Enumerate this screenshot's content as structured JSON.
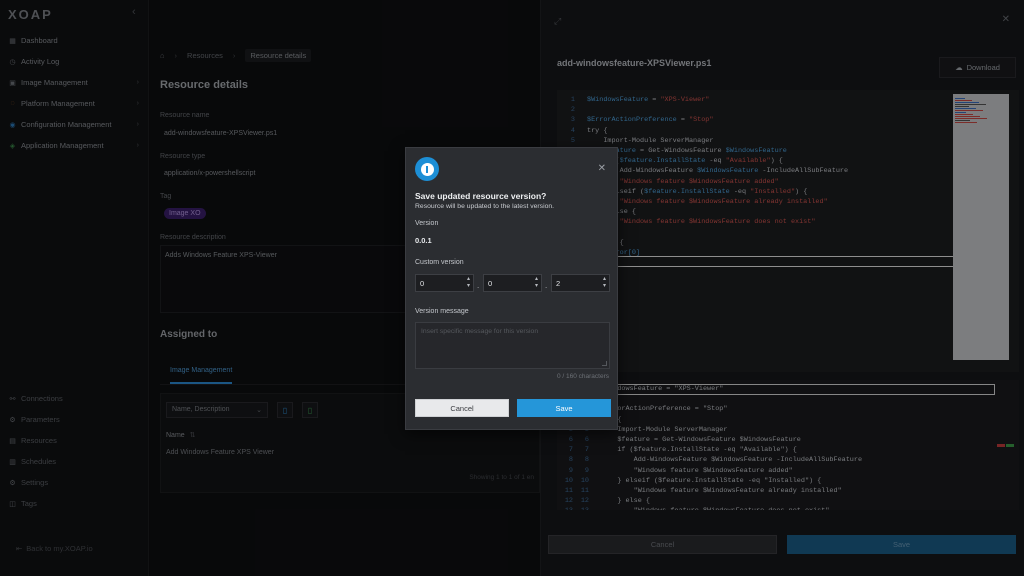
{
  "app": {
    "logo": "XOAP"
  },
  "sidebar": {
    "items": [
      {
        "label": "Dashboard",
        "icon": "dashboard-icon"
      },
      {
        "label": "Activity Log",
        "icon": "clock-icon"
      },
      {
        "label": "Image Management",
        "icon": "image-icon"
      },
      {
        "label": "Platform Management",
        "icon": "platform-icon"
      },
      {
        "label": "Configuration Management",
        "icon": "config-icon"
      },
      {
        "label": "Application Management",
        "icon": "apps-icon"
      }
    ],
    "bottom_items": [
      {
        "label": "Connections",
        "icon": "link-icon"
      },
      {
        "label": "Parameters",
        "icon": "parameters-icon"
      },
      {
        "label": "Resources",
        "icon": "resources-icon"
      },
      {
        "label": "Schedules",
        "icon": "calendar-icon"
      },
      {
        "label": "Settings",
        "icon": "gear-icon"
      },
      {
        "label": "Tags",
        "icon": "tag-icon"
      }
    ],
    "back_link": "Back to my.XOAP.io"
  },
  "main": {
    "breadcrumb": {
      "parent": "Resources",
      "current": "Resource details"
    },
    "title": "Resource details",
    "resource_name_label": "Resource name",
    "resource_name": "add-windowsfeature-XPSViewer.ps1",
    "resource_type_label": "Resource type",
    "resource_type": "application/x-powershellscript",
    "tag_label": "Tag",
    "tag": "Image XO",
    "description_label": "Resource description",
    "description": "Adds Windows Feature XPS-Viewer",
    "assigned_title": "Assigned to",
    "assigned_tab": "Image Management",
    "filter_placeholder": "Name, Description",
    "column_name": "Name",
    "row_name": "Add Windows Feature XPS Viewer",
    "paging": "Showing 1 to 1 of 1 en"
  },
  "drawer": {
    "file_title": "add-windowsfeature-XPSViewer.ps1",
    "download_label": "Download",
    "cancel_label": "Cancel",
    "save_label": "Save"
  },
  "code": [
    {
      "n": "1",
      "text": "$WindowsFeature = \"XPS-Viewer\""
    },
    {
      "n": "2",
      "text": ""
    },
    {
      "n": "3",
      "text": "$ErrorActionPreference = \"Stop\""
    },
    {
      "n": "4",
      "text": "try {"
    },
    {
      "n": "5",
      "text": "    Import-Module ServerManager"
    },
    {
      "n": "6",
      "text": "    $feature = Get-WindowsFeature $WindowsFeature"
    },
    {
      "n": "7",
      "text": "    if ($feature.InstallState -eq \"Available\") {"
    },
    {
      "n": "8",
      "text": "        Add-WindowsFeature $WindowsFeature -IncludeAllSubFeature"
    },
    {
      "n": "9",
      "text": "        \"Windows feature $WindowsFeature added\""
    },
    {
      "n": "10",
      "text": "    } elseif ($feature.InstallState -eq \"Installed\") {"
    },
    {
      "n": "11",
      "text": "        \"Windows feature $WindowsFeature already installed\""
    },
    {
      "n": "12",
      "text": "    } else {"
    },
    {
      "n": "13",
      "text": "        \"Windows feature $WindowsFeature does not exist\""
    },
    {
      "n": "14",
      "text": "    }"
    },
    {
      "n": "15",
      "text": "} catch {"
    },
    {
      "n": "16",
      "text": "    $error[0]"
    }
  ],
  "diff": [
    {
      "a": "1",
      "b": "1",
      "text": "$WindowsFeature = \"XPS-Viewer\""
    },
    {
      "a": "2",
      "b": "2",
      "text": ""
    },
    {
      "a": "3",
      "b": "3",
      "text": "$ErrorActionPreference = \"Stop\""
    },
    {
      "a": "4",
      "b": "4",
      "text": "try {"
    },
    {
      "a": "5",
      "b": "5",
      "text": "    Import-Module ServerManager"
    },
    {
      "a": "6",
      "b": "6",
      "text": "    $feature = Get-WindowsFeature $WindowsFeature"
    },
    {
      "a": "7",
      "b": "7",
      "text": "    if ($feature.InstallState -eq \"Available\") {"
    },
    {
      "a": "8",
      "b": "8",
      "text": "        Add-WindowsFeature $WindowsFeature -IncludeAllSubFeature"
    },
    {
      "a": "9",
      "b": "9",
      "text": "        \"Windows feature $WindowsFeature added\""
    },
    {
      "a": "10",
      "b": "10",
      "text": "    } elseif ($feature.InstallState -eq \"Installed\") {"
    },
    {
      "a": "11",
      "b": "11",
      "text": "        \"Windows feature $WindowsFeature already installed\""
    },
    {
      "a": "12",
      "b": "12",
      "text": "    } else {"
    },
    {
      "a": "13",
      "b": "13",
      "text": "        \"Windows feature $WindowsFeature does not exist\""
    }
  ],
  "modal": {
    "title": "Save updated resource version?",
    "subtitle": "Resource will be updated to the latest version.",
    "version_label": "Version",
    "version_value": "0.0.1",
    "custom_version_label": "Custom version",
    "major": "0",
    "minor": "0",
    "patch": "2",
    "message_label": "Version message",
    "message_placeholder": "Insert specific message for this version",
    "counter": "0 / 160 characters",
    "cancel_label": "Cancel",
    "save_label": "Save"
  },
  "colors": {
    "accent": "#2596d9",
    "tag_bg": "#3b1f6b",
    "code_variable": "#4fa4e0",
    "code_string": "#d4554f"
  }
}
